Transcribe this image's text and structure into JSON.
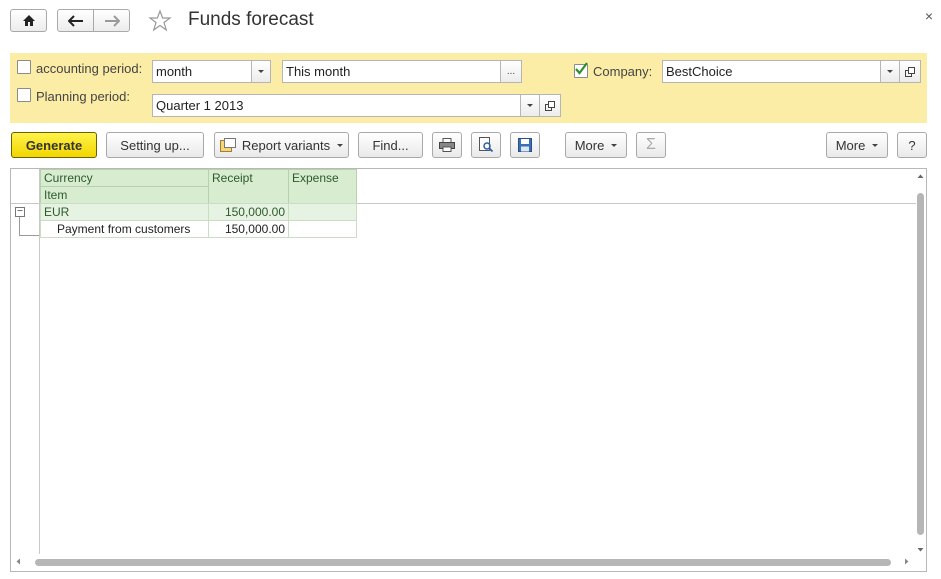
{
  "window": {
    "title": "Funds forecast",
    "close_glyph": "×"
  },
  "nav": {
    "home_icon": "home-icon",
    "back_icon": "arrow-left-icon",
    "forward_icon": "arrow-right-icon",
    "favorite_icon": "star-icon"
  },
  "filters": {
    "accounting_period": {
      "label": "accounting period:",
      "checked": false,
      "unit": "month",
      "value": "This month",
      "select_btn": "..."
    },
    "planning_period": {
      "label": "Planning period:",
      "checked": false,
      "value": "Quarter 1 2013"
    },
    "company": {
      "label": "Company:",
      "checked": true,
      "value": "BestChoice"
    }
  },
  "toolbar": {
    "generate": "Generate",
    "setting_up": "Setting up...",
    "report_variants": "Report variants",
    "find": "Find...",
    "more1": "More",
    "sigma": "Σ",
    "more2": "More",
    "help": "?"
  },
  "report": {
    "headers": {
      "currency": "Currency",
      "item": "Item",
      "receipt": "Receipt",
      "expense": "Expense"
    },
    "rows": [
      {
        "name": "EUR",
        "receipt": "150,000.00",
        "expense": ""
      },
      {
        "name": "Payment from customers",
        "receipt": "150,000.00",
        "expense": ""
      }
    ],
    "collapse_glyph": "−"
  },
  "colors": {
    "filter_panel": "#fbeda6",
    "generate_button": "#f7e000",
    "table_header": "#d8ecd0",
    "table_text": "#2d5a2d"
  }
}
